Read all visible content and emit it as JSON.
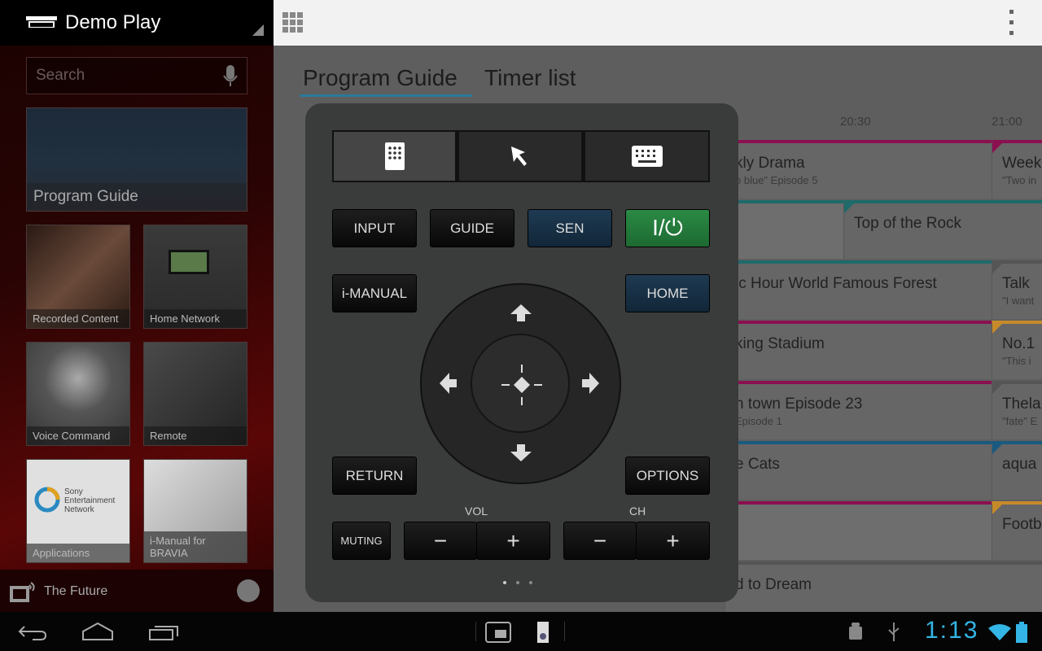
{
  "sidebar": {
    "title": "Demo Play",
    "search_placeholder": "Search",
    "featured": "Program Guide",
    "tiles": [
      "Recorded Content",
      "Home Network",
      "Voice Command",
      "Remote",
      "Applications",
      "i-Manual for BRAVIA"
    ],
    "sony_logo_text": "Sony Entertainment Network",
    "footer": "The Future"
  },
  "tabs": [
    "Program Guide",
    "Timer list"
  ],
  "guide": {
    "times": [
      "20:30",
      "21:00"
    ],
    "colors": {
      "magenta": "#8a1050",
      "teal": "#1f6a6a",
      "orange": "#c78a2a",
      "gray": "#555555",
      "blue": "#1a5a80"
    },
    "rows": [
      {
        "left": {
          "title": "kly Drama",
          "sub": "o blue\" Episode 5",
          "color": "magenta"
        },
        "right": {
          "title": "Week",
          "sub": "\"Two in",
          "color": "magenta"
        }
      },
      {
        "left": {
          "title": "",
          "sub": "",
          "color": "teal",
          "light": true
        },
        "mid": {
          "title": "Top of the Rock",
          "color": "teal"
        }
      },
      {
        "left": {
          "title": "ic Hour World Famous Forest",
          "sub": "",
          "color": "teal"
        },
        "right": {
          "title": "Talk",
          "sub": "\"I want",
          "color": "gray"
        }
      },
      {
        "left": {
          "title": "king Stadium",
          "sub": "",
          "color": "magenta"
        },
        "right": {
          "title": "No.1",
          "sub": "\"This i",
          "color": "orange"
        }
      },
      {
        "left": {
          "title": "n town Episode 23",
          "sub": "Episode 1",
          "color": "magenta"
        },
        "right": {
          "title": "Thela",
          "sub": "\"fate\" E",
          "color": "gray"
        }
      },
      {
        "left": {
          "title": "e Cats",
          "sub": "",
          "color": "blue"
        },
        "right": {
          "title": "aqua",
          "sub": "",
          "color": "blue"
        }
      },
      {
        "left": {
          "title": "",
          "sub": "",
          "color": "magenta",
          "light": true
        },
        "right": {
          "title": "Footb",
          "sub": "",
          "color": "orange"
        }
      },
      {
        "left": {
          "title": "d to Dream",
          "sub": "",
          "color": "gray",
          "full": true
        }
      }
    ]
  },
  "remote": {
    "modes": [
      "remote-keypad",
      "pointer",
      "keyboard"
    ],
    "input": "INPUT",
    "guide": "GUIDE",
    "sen": "SEN",
    "power": "I/⏻",
    "imanual": "i-MANUAL",
    "home": "HOME",
    "return": "RETURN",
    "options": "OPTIONS",
    "muting": "MUTING",
    "vol": "VOL",
    "ch": "CH",
    "minus": "−",
    "plus": "+",
    "page_count": 3,
    "page_active": 1
  },
  "status": {
    "time": "1:13",
    "accent": "#33b5e5"
  }
}
